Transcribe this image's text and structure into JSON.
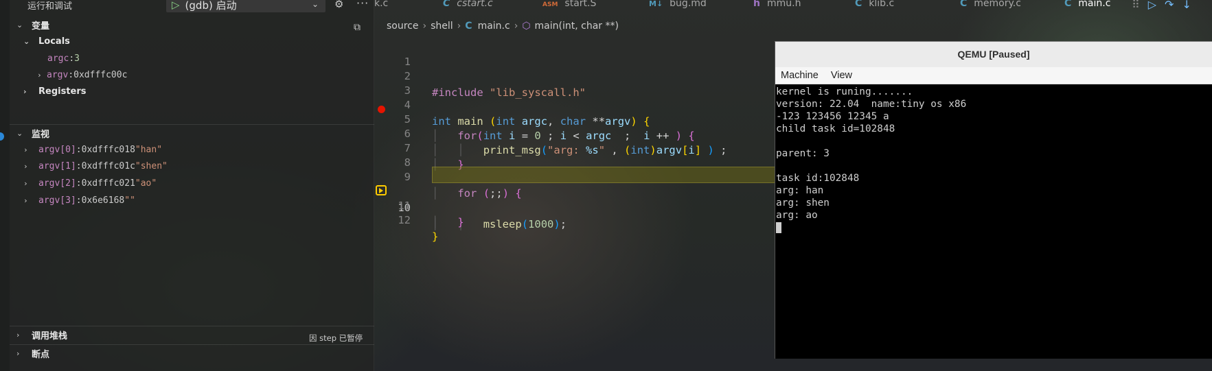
{
  "run_panel": {
    "title": "运行和调试",
    "config_label": "(gdb) 启动"
  },
  "variables": {
    "header": "变量",
    "locals_label": "Locals",
    "argc": {
      "name": "argc",
      "value": "3"
    },
    "argv": {
      "name": "argv",
      "value": "0xdfffc00c"
    },
    "registers_label": "Registers"
  },
  "watch": {
    "header": "监视",
    "items": [
      {
        "name": "argv[0]",
        "sep": ": ",
        "value": "0xdfffc018 ",
        "str": "\"han\""
      },
      {
        "name": "argv[1]",
        "sep": ": ",
        "value": "0xdfffc01c ",
        "str": "\"shen\""
      },
      {
        "name": "argv[2] ",
        "sep": ": ",
        "value": "0xdfffc021 ",
        "str": "\"ao\""
      },
      {
        "name": "argv[3]",
        "sep": ": ",
        "value": "0x6e6168 ",
        "str": "\"\""
      }
    ]
  },
  "call_stack": {
    "header": "调用堆栈",
    "status": "因 step 已暂停"
  },
  "breakpoints": {
    "header": "断点"
  },
  "tabs": [
    {
      "label": "k.c",
      "icon": ""
    },
    {
      "label": "cstart.c",
      "icon": "C"
    },
    {
      "label": "start.S",
      "icon": "ASM"
    },
    {
      "label": "bug.md",
      "icon": "M↓"
    },
    {
      "label": "mmu.h",
      "icon": "h"
    },
    {
      "label": "klib.c",
      "icon": "C"
    },
    {
      "label": "memory.c",
      "icon": "C"
    },
    {
      "label": "main.c",
      "icon": "C"
    }
  ],
  "breadcrumb": {
    "seg1": "source",
    "seg2": "shell",
    "seg3": "main.c",
    "seg4": "main(int, char **)"
  },
  "code": {
    "line_numbers": [
      "1",
      "2",
      "3",
      "4",
      "5",
      "6",
      "7",
      "8",
      "9",
      "10",
      "11",
      "12"
    ],
    "breakpoint_line": 5,
    "current_line": 10,
    "l1_kw": "#include",
    "l1_str": "\"lib_syscall.h\"",
    "l3_ty": "int",
    "l3_fn": "main",
    "l3_ty2": "int",
    "l3_arg1": "argc",
    "l3_ty3": "char",
    "l3_ptr": "**",
    "l3_arg2": "argv",
    "l4_kw": "for",
    "l4_ty": "int",
    "l4_i": "i",
    "l4_zero": "0",
    "l4_i2": "i",
    "l4_argc": "argc",
    "l4_i3": "i",
    "l5_fn": "print_msg",
    "l5_str": "\"arg: ",
    "l5_fmt": "%s",
    "l5_str2": "\"",
    "l5_ty": "int",
    "l5_argv": "argv",
    "l5_i": "i",
    "l8_kw": "for",
    "l9_fn": "msleep",
    "l9_num": "1000"
  },
  "qemu": {
    "title": "QEMU [Paused]",
    "menu": [
      "Machine",
      "View"
    ],
    "lines": [
      "kernel is runing.......",
      "version: 22.04  name:tiny os x86",
      "-123 123456 12345 a",
      "child task id=102848",
      "",
      "parent: 3",
      "",
      "task id:102848",
      "arg: han",
      "arg: shen",
      "arg: ao"
    ]
  },
  "colors": {
    "accent": "#2b88d8",
    "breakpoint": "#e51400",
    "current_line_highlight": "#78731a",
    "exec_arrow": "#ffcc00"
  }
}
